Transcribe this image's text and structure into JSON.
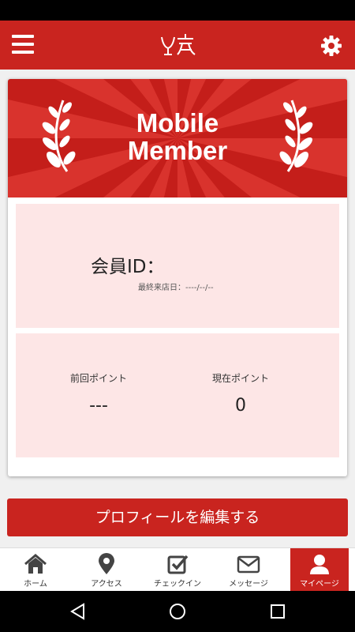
{
  "app": {
    "logo_label": "logo",
    "menu_icon": "hamburger-menu-icon",
    "settings_icon": "gear-icon"
  },
  "banner": {
    "title_line1": "Mobile",
    "title_line2": "Member"
  },
  "member": {
    "id_label": "会員ID：",
    "last_visit": "最終来店日：----/--/--"
  },
  "points": {
    "previous_label": "前回ポイント",
    "previous_value": "---",
    "current_label": "現在ポイント",
    "current_value": "0"
  },
  "edit_profile_label": "プロフィールを編集する",
  "tabs": [
    {
      "label": "ホーム",
      "icon": "home-icon",
      "active": false
    },
    {
      "label": "アクセス",
      "icon": "map-pin-icon",
      "active": false
    },
    {
      "label": "チェックイン",
      "icon": "checkbox-icon",
      "active": false
    },
    {
      "label": "メッセージ",
      "icon": "envelope-icon",
      "active": false
    },
    {
      "label": "マイページ",
      "icon": "user-icon",
      "active": true
    }
  ],
  "colors": {
    "accent": "#c9241f",
    "panel": "#fde6e6",
    "banner": "#c41e1a"
  }
}
